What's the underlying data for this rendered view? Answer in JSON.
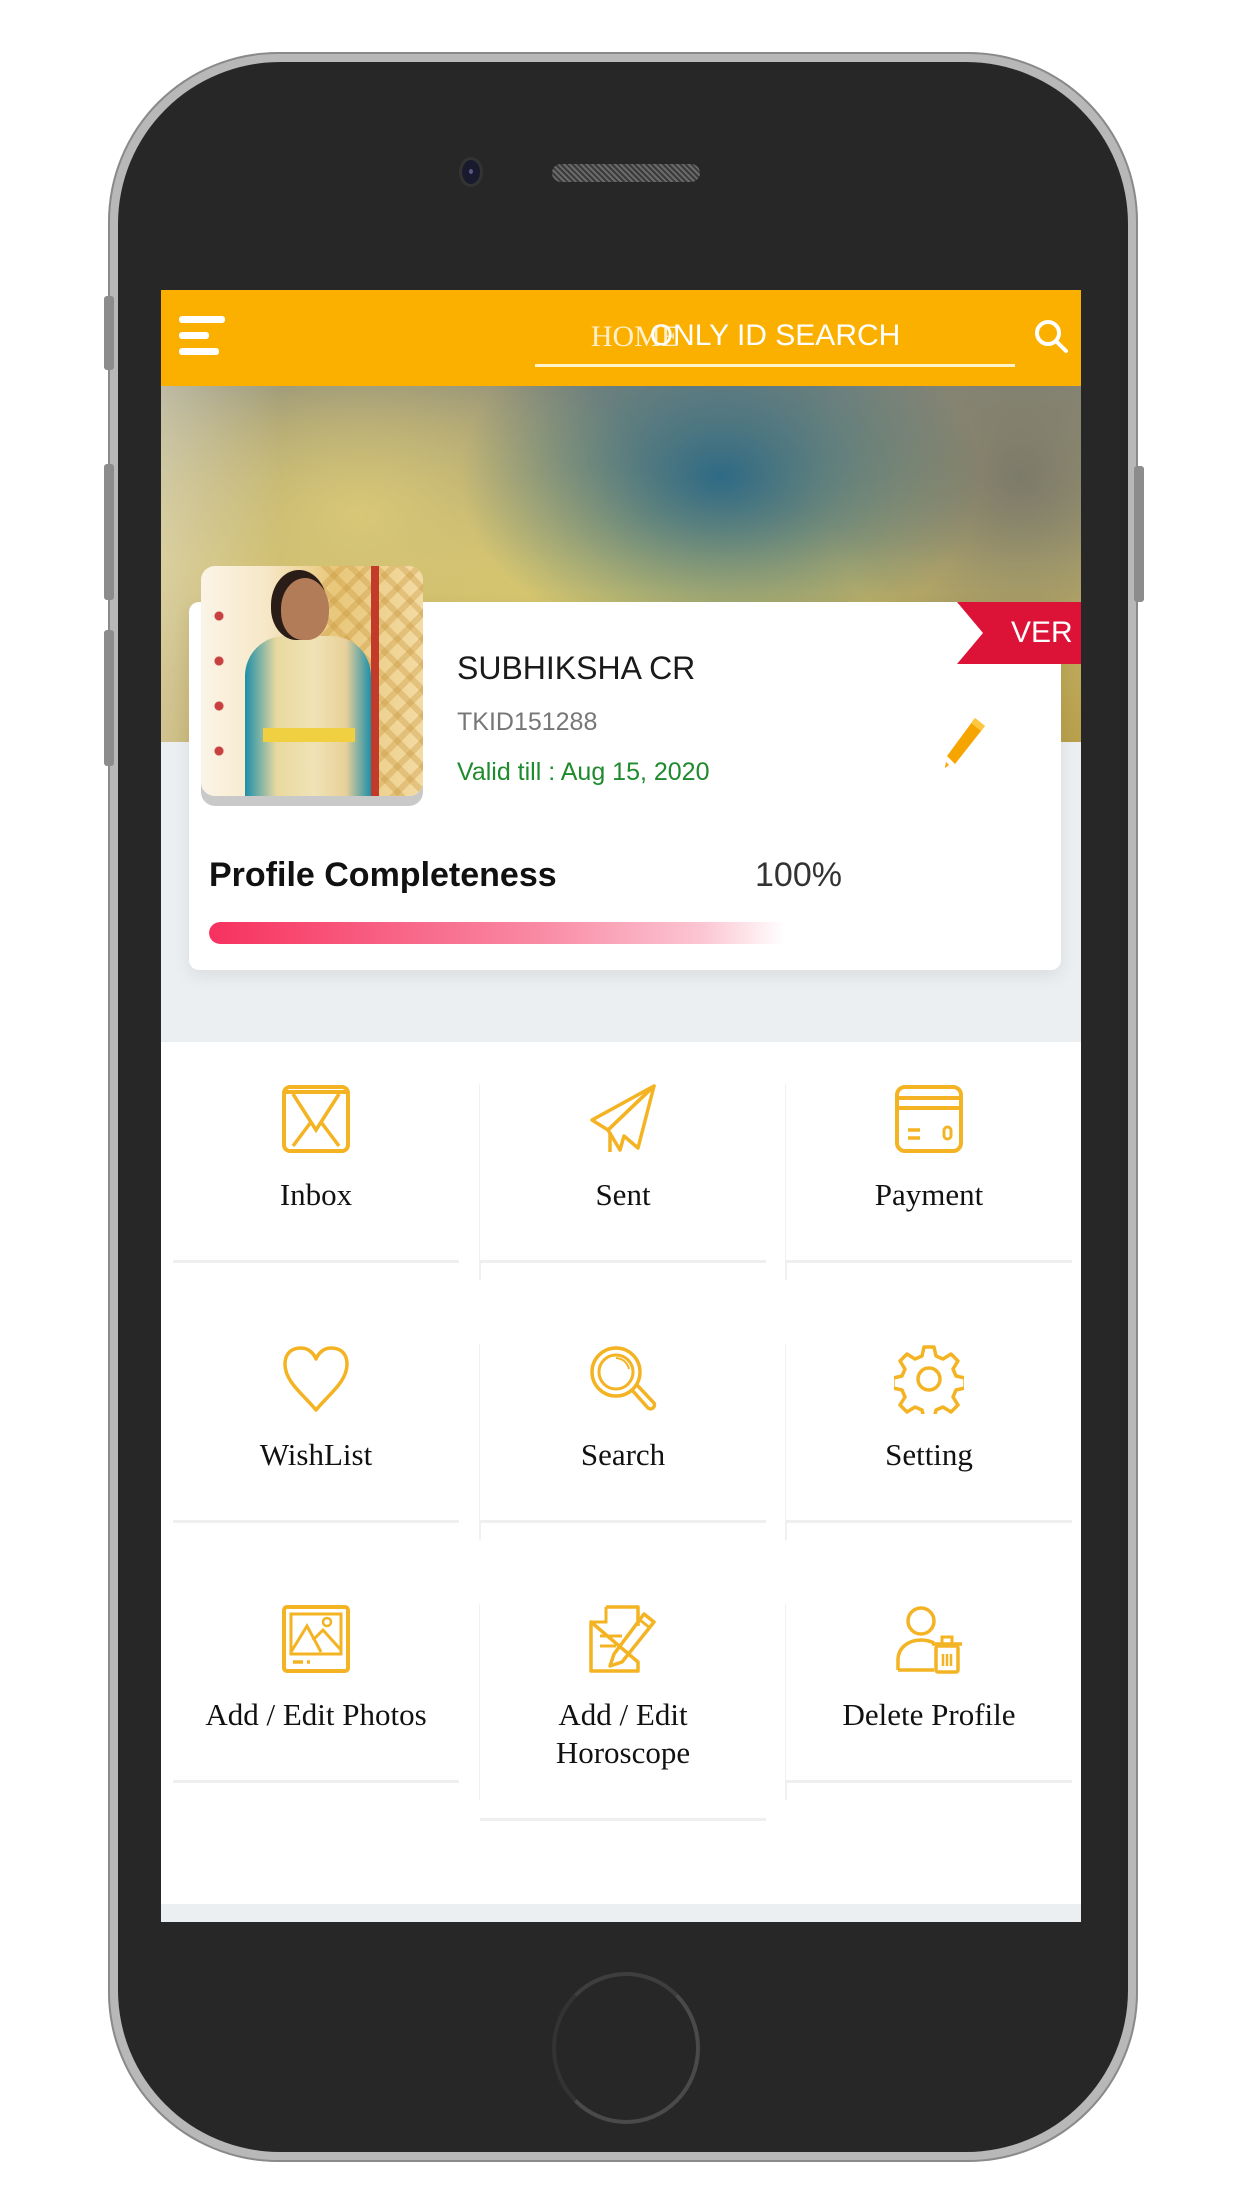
{
  "app": {
    "accent_color": "#fbb000",
    "header": {
      "title": "HOME",
      "search_placeholder": "ONLY ID SEARCH",
      "menu_icon": "hamburger-menu-icon",
      "search_icon": "search-icon"
    },
    "profile": {
      "name": "SUBHIKSHA CR",
      "id": "TKID151288",
      "validity": "Valid till : Aug 15, 2020",
      "badge": "VERIFIED",
      "badge_visible_text": "VER",
      "badge_color": "#dc1237",
      "edit_icon": "pencil-icon",
      "completeness_label": "Profile Completeness",
      "completeness_value": "100%",
      "completeness_fraction": 1.0
    },
    "menu": [
      {
        "label": "Inbox",
        "icon": "envelope-icon"
      },
      {
        "label": "Sent",
        "icon": "paper-plane-icon"
      },
      {
        "label": "Payment",
        "icon": "credit-card-icon"
      },
      {
        "label": "WishList",
        "icon": "heart-icon"
      },
      {
        "label": "Search",
        "icon": "magnifier-icon"
      },
      {
        "label": "Setting",
        "icon": "gear-icon"
      },
      {
        "label": "Add / Edit Photos",
        "icon": "image-icon"
      },
      {
        "label": "Add / Edit Horoscope",
        "icon": "document-edit-icon"
      },
      {
        "label": "Delete Profile",
        "icon": "user-delete-icon"
      }
    ]
  }
}
